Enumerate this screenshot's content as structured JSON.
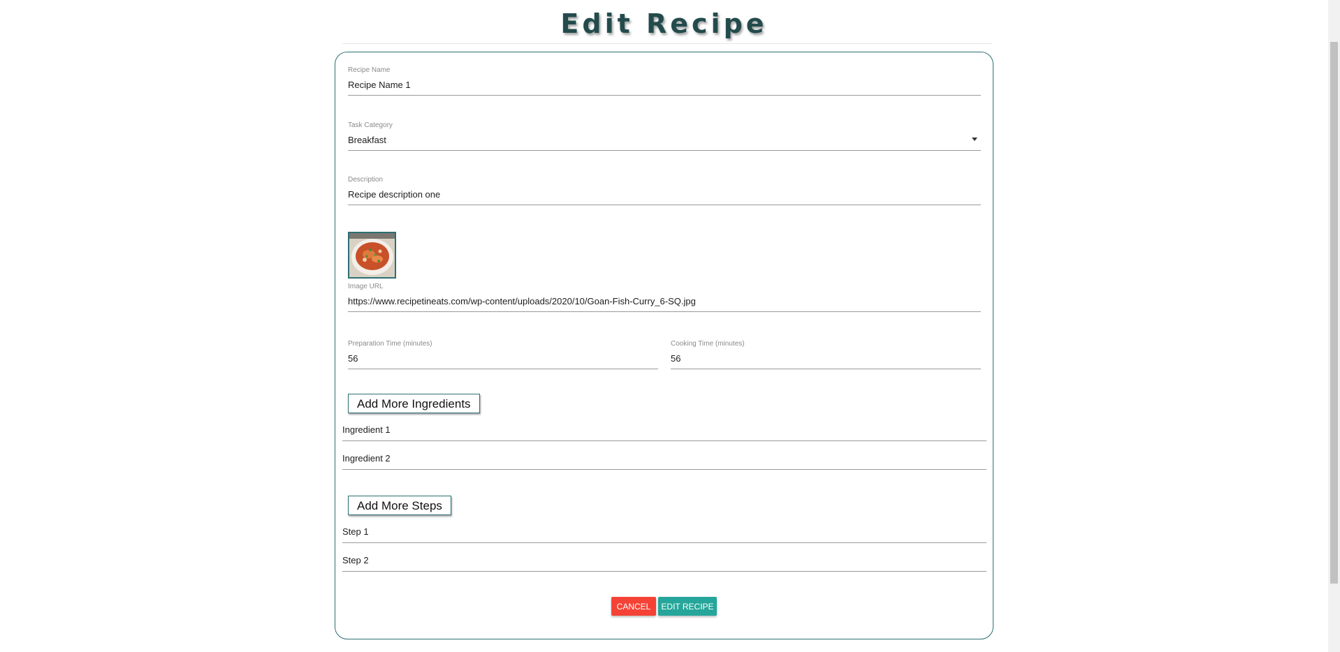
{
  "page": {
    "title": "Edit Recipe"
  },
  "form": {
    "recipe_name": {
      "label": "Recipe Name",
      "value": "Recipe Name 1"
    },
    "category": {
      "label": "Task Category",
      "value": "Breakfast"
    },
    "description": {
      "label": "Description",
      "value": "Recipe description one"
    },
    "image_url": {
      "label": "Image URL",
      "value": "https://www.recipetineats.com/wp-content/uploads/2020/10/Goan-Fish-Curry_6-SQ.jpg"
    },
    "prep_time": {
      "label": "Preparation Time (minutes)",
      "value": "56"
    },
    "cook_time": {
      "label": "Cooking Time (minutes)",
      "value": "56"
    }
  },
  "ingredients": {
    "add_button": "Add More Ingredients",
    "items": [
      "Ingredient 1",
      "Ingredient 2"
    ]
  },
  "steps": {
    "add_button": "Add More Steps",
    "items": [
      "Step 1",
      "Step 2"
    ]
  },
  "actions": {
    "cancel": "CANCEL",
    "submit": "EDIT RECIPE"
  },
  "colors": {
    "accent": "#2d6f72",
    "cancel": "#f44336",
    "submit": "#26a69a",
    "title": "#234b4c"
  }
}
